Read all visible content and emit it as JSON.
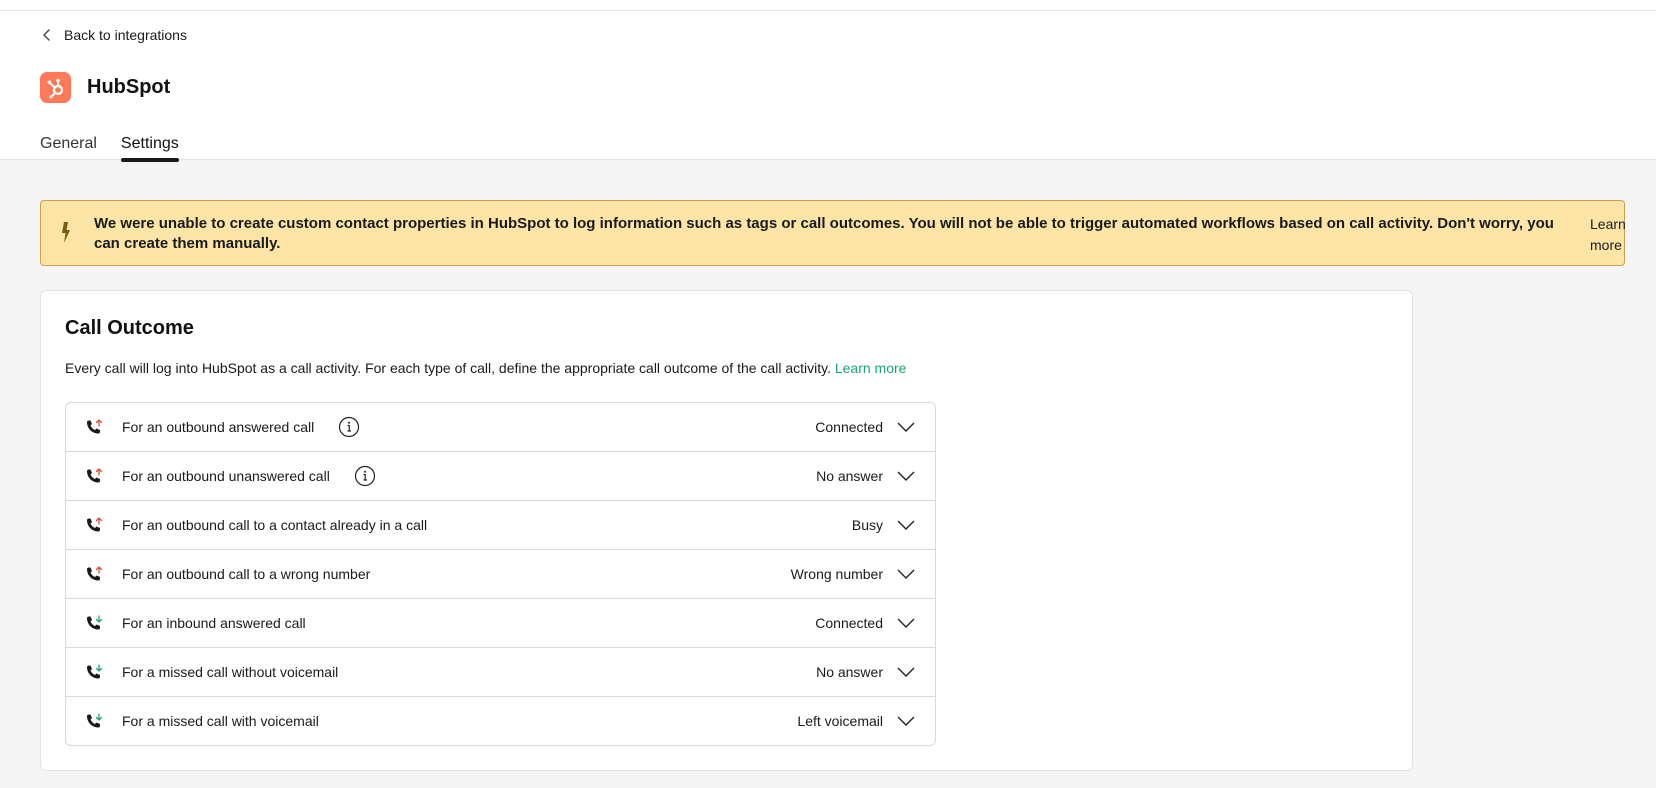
{
  "nav": {
    "back_label": "Back to integrations"
  },
  "app": {
    "name": "HubSpot",
    "brand_color": "#ff7a59"
  },
  "tabs": [
    {
      "label": "General",
      "active": false
    },
    {
      "label": "Settings",
      "active": true
    }
  ],
  "banner": {
    "message": "We were unable to create custom contact properties in HubSpot to log information such as tags or call outcomes. You will not be able to trigger automated workflows based on call activity. Don't worry, you can create them manually.",
    "link_label": "Learn more",
    "icon": "lightning-icon",
    "bg_color": "#fde5a8"
  },
  "call_outcome": {
    "title": "Call Outcome",
    "description": "Every call will log into HubSpot as a call activity. For each type of call, define the appropriate call outcome of the call activity.",
    "learn_more": "Learn more",
    "link_color": "#1aa67c",
    "rows": [
      {
        "label": "For an outbound answered call",
        "value": "Connected",
        "direction": "outbound",
        "info": true
      },
      {
        "label": "For an outbound unanswered call",
        "value": "No answer",
        "direction": "outbound",
        "info": true
      },
      {
        "label": "For an outbound call to a contact already in a call",
        "value": "Busy",
        "direction": "outbound",
        "info": false
      },
      {
        "label": "For an outbound call to a wrong number",
        "value": "Wrong number",
        "direction": "outbound",
        "info": false
      },
      {
        "label": "For an inbound answered call",
        "value": "Connected",
        "direction": "inbound",
        "info": false
      },
      {
        "label": "For a missed call without voicemail",
        "value": "No answer",
        "direction": "inbound",
        "info": false
      },
      {
        "label": "For a missed call with voicemail",
        "value": "Left voicemail",
        "direction": "inbound",
        "info": false
      }
    ]
  }
}
